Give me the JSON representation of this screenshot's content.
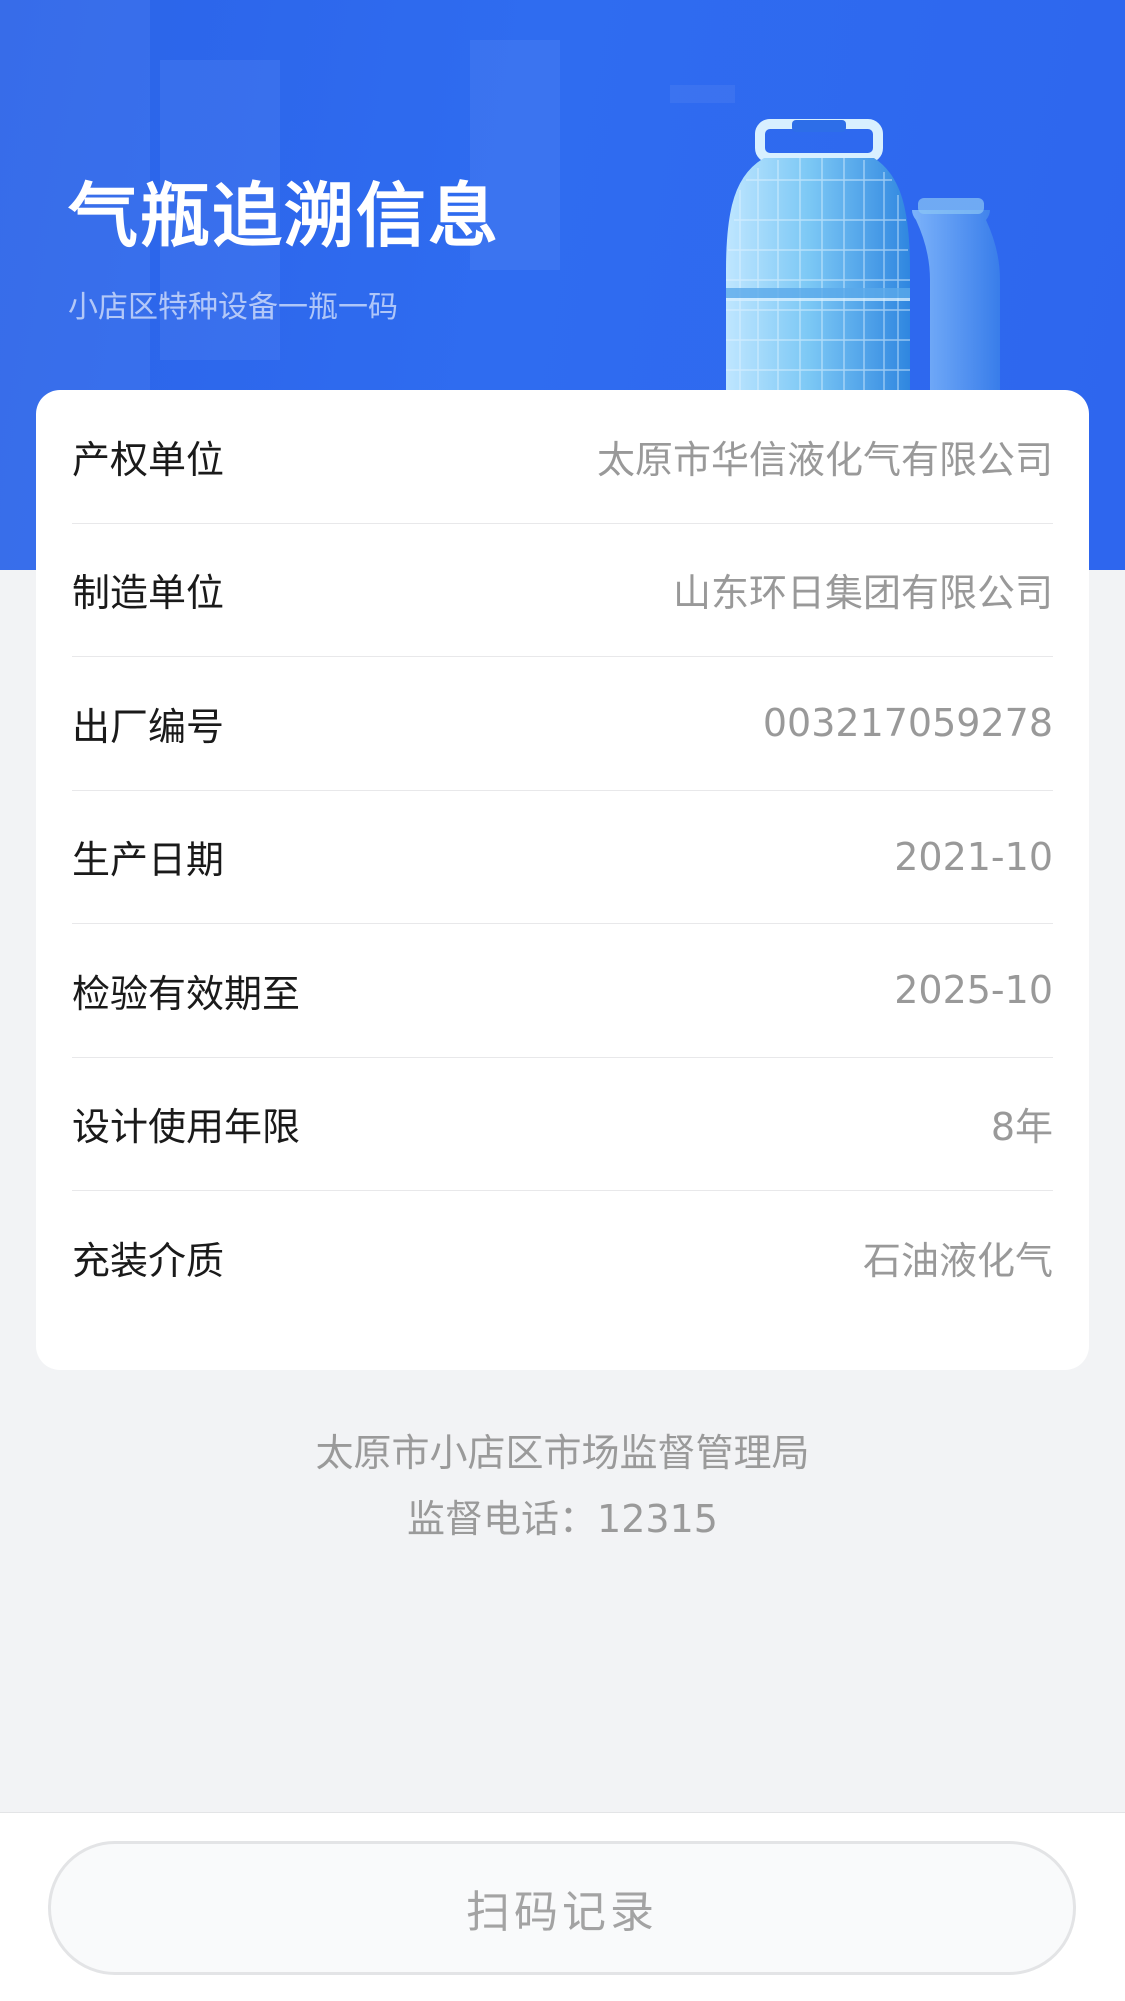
{
  "header": {
    "title": "气瓶追溯信息",
    "subtitle": "小店区特种设备一瓶一码",
    "illustration_icon": "gas-cylinder-icon"
  },
  "info": {
    "rows": [
      {
        "label": "产权单位",
        "value": "太原市华信液化气有限公司"
      },
      {
        "label": "制造单位",
        "value": "山东环日集团有限公司"
      },
      {
        "label": "出厂编号",
        "value": "003217059278"
      },
      {
        "label": "生产日期",
        "value": "2021-10"
      },
      {
        "label": "检验有效期至",
        "value": "2025-10"
      },
      {
        "label": "设计使用年限",
        "value": "8年"
      },
      {
        "label": "充装介质",
        "value": "石油液化气"
      }
    ]
  },
  "footer": {
    "authority": "太原市小店区市场监督管理局",
    "hotline": "监督电话：12315"
  },
  "bottom_bar": {
    "scan_record_label": "扫码记录"
  },
  "colors": {
    "header_blue": "#2e66ee",
    "background": "#f2f3f5",
    "label_text": "#1a1a1a",
    "value_text": "#999999"
  }
}
